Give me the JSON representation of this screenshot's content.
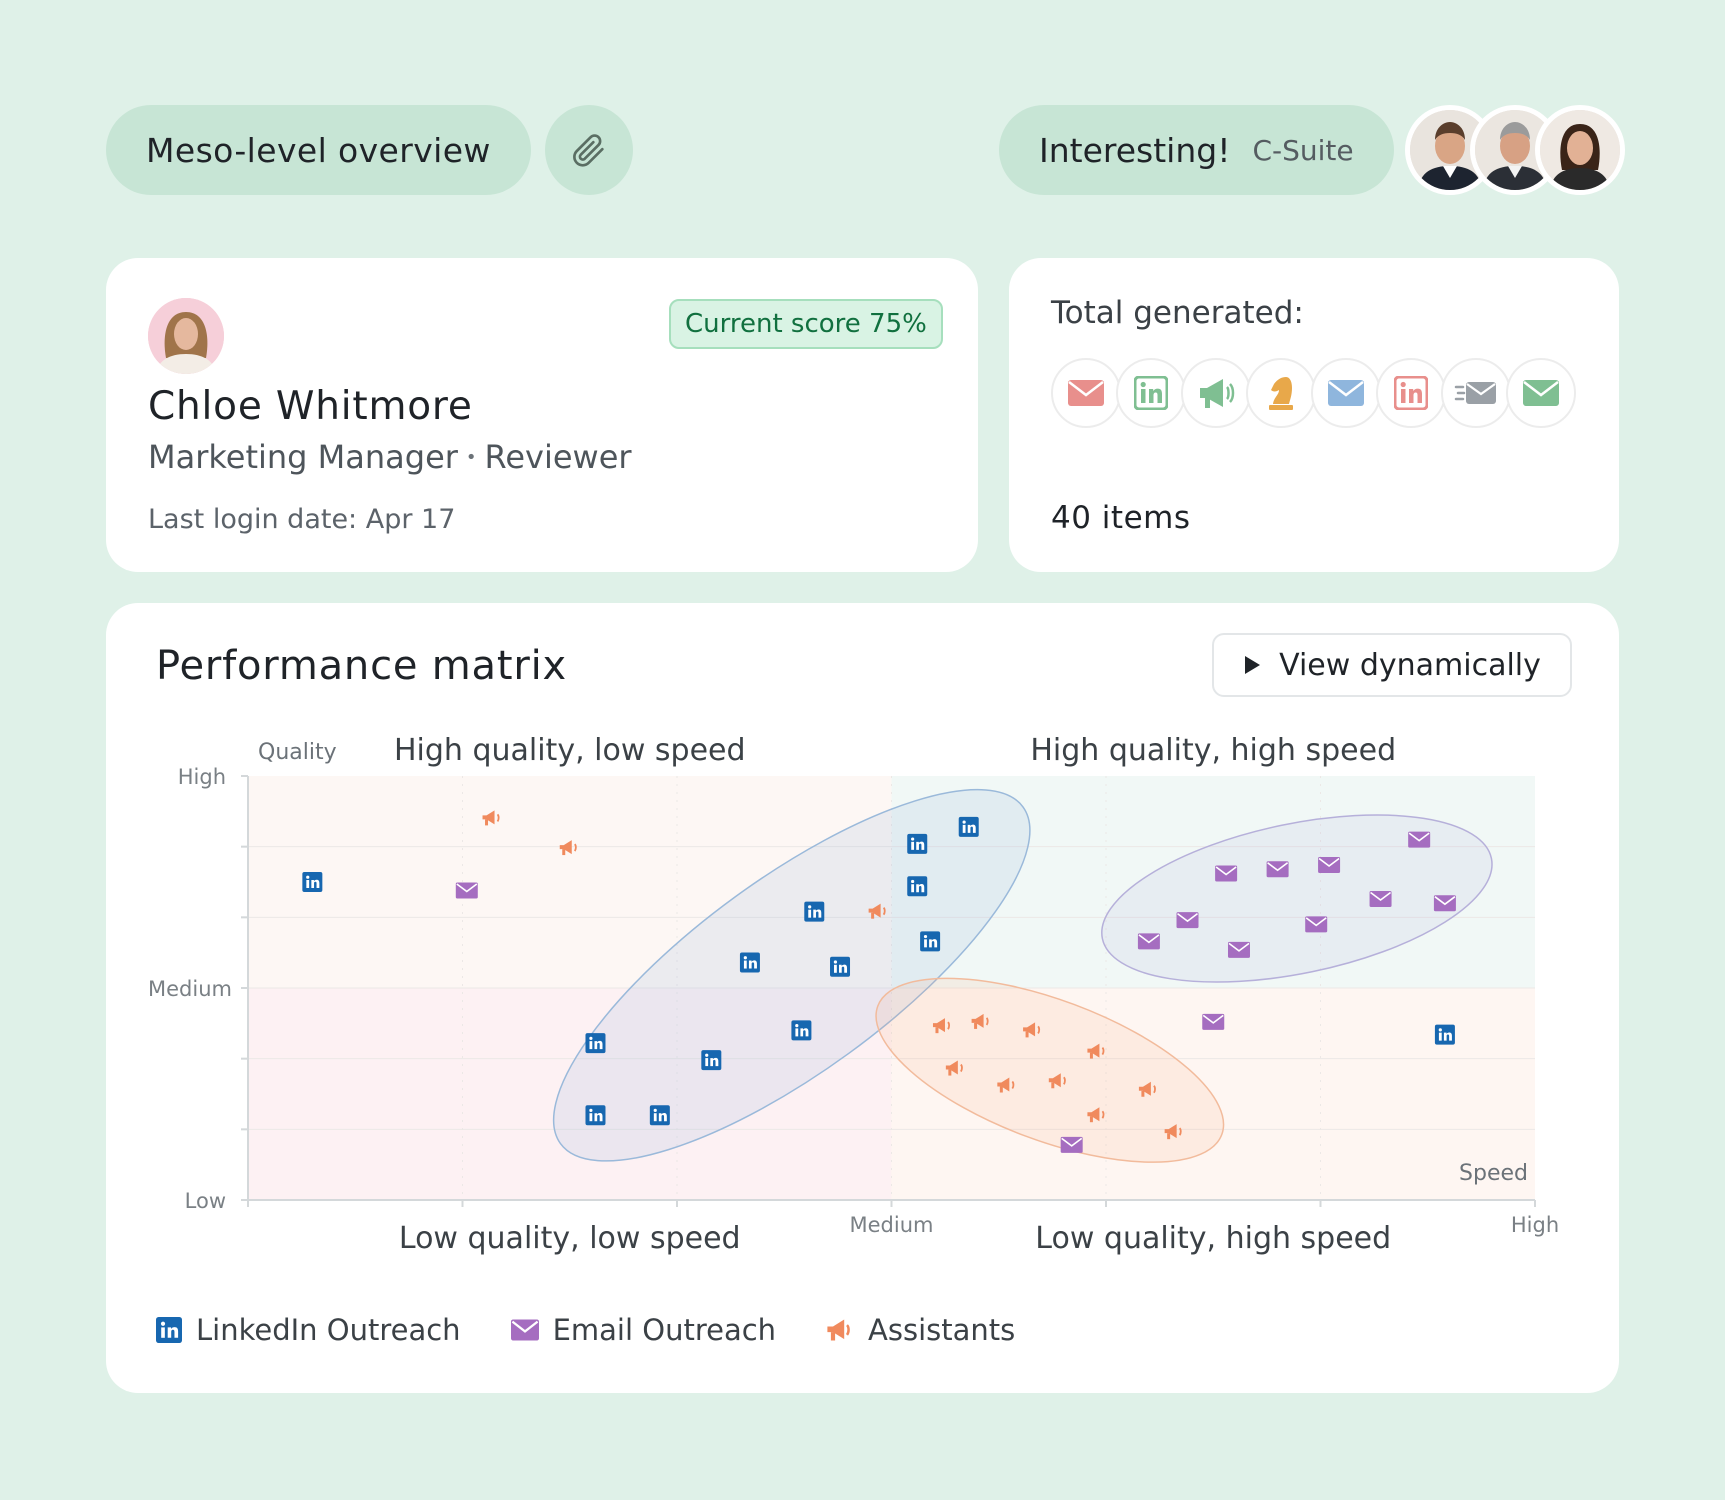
{
  "header": {
    "overview_label": "Meso-level overview",
    "interest_label": "Interesting!",
    "segment_label": "C-Suite"
  },
  "profile": {
    "score_badge": "Current score 75%",
    "name": "Chloe Whitmore",
    "role": "Marketing Manager",
    "role_separator": "•",
    "status": "Reviewer",
    "last_login": "Last login date: Apr 17"
  },
  "total": {
    "label": "Total generated:",
    "items": "40 items",
    "icons": [
      {
        "icon": "mail-icon",
        "color": "#e88f8c"
      },
      {
        "icon": "linkedin-icon",
        "color": "#7fbf92"
      },
      {
        "icon": "megaphone-icon",
        "color": "#7fbf92"
      },
      {
        "icon": "chess-knight-icon",
        "color": "#e8a84a"
      },
      {
        "icon": "mail-icon",
        "color": "#8fb6dd"
      },
      {
        "icon": "linkedin-icon",
        "color": "#e88f8c"
      },
      {
        "icon": "fast-mail-icon",
        "color": "#9aa0a6"
      },
      {
        "icon": "mail-icon",
        "color": "#7fbf92"
      }
    ]
  },
  "matrix": {
    "title": "Performance matrix",
    "view_button": "View dynamically"
  },
  "colors": {
    "background": "#dff1e8",
    "linkedin": "#1767b0",
    "email": "#a56dc0",
    "assistant": "#f08a5d"
  },
  "chart_data": {
    "type": "scatter",
    "xlabel": "Speed",
    "ylabel": "Quality",
    "x_ticks": [
      "Medium",
      "High"
    ],
    "y_ticks": [
      "High",
      "Medium",
      "Low"
    ],
    "xlim": [
      0,
      1
    ],
    "ylim": [
      0,
      1
    ],
    "quadrants": [
      {
        "label": "High quality, low speed"
      },
      {
        "label": "High quality, high speed"
      },
      {
        "label": "Low quality, low speed"
      },
      {
        "label": "Low quality, high speed"
      }
    ],
    "series": [
      {
        "name": "LinkedIn Outreach",
        "color": "#1767b0",
        "points": [
          [
            0.05,
            0.75
          ],
          [
            0.52,
            0.84
          ],
          [
            0.56,
            0.88
          ],
          [
            0.52,
            0.74
          ],
          [
            0.44,
            0.68
          ],
          [
            0.53,
            0.61
          ],
          [
            0.39,
            0.56
          ],
          [
            0.46,
            0.55
          ],
          [
            0.43,
            0.4
          ],
          [
            0.27,
            0.37
          ],
          [
            0.36,
            0.33
          ],
          [
            0.27,
            0.2
          ],
          [
            0.32,
            0.2
          ],
          [
            0.93,
            0.39
          ]
        ]
      },
      {
        "name": "Email Outreach",
        "color": "#a56dc0",
        "points": [
          [
            0.17,
            0.73
          ],
          [
            0.91,
            0.85
          ],
          [
            0.76,
            0.77
          ],
          [
            0.8,
            0.78
          ],
          [
            0.84,
            0.79
          ],
          [
            0.88,
            0.71
          ],
          [
            0.93,
            0.7
          ],
          [
            0.73,
            0.66
          ],
          [
            0.7,
            0.61
          ],
          [
            0.77,
            0.59
          ],
          [
            0.83,
            0.65
          ],
          [
            0.75,
            0.42
          ],
          [
            0.64,
            0.13
          ]
        ]
      },
      {
        "name": "Assistants",
        "color": "#f08a5d",
        "points": [
          [
            0.19,
            0.9
          ],
          [
            0.25,
            0.83
          ],
          [
            0.49,
            0.68
          ],
          [
            0.54,
            0.41
          ],
          [
            0.57,
            0.42
          ],
          [
            0.61,
            0.4
          ],
          [
            0.55,
            0.31
          ],
          [
            0.59,
            0.27
          ],
          [
            0.63,
            0.28
          ],
          [
            0.66,
            0.35
          ],
          [
            0.66,
            0.2
          ],
          [
            0.7,
            0.26
          ],
          [
            0.72,
            0.16
          ]
        ]
      }
    ],
    "clusters": [
      {
        "series": "LinkedIn Outreach"
      },
      {
        "series": "Email Outreach"
      },
      {
        "series": "Assistants"
      }
    ],
    "legend_position": "bottom-left"
  }
}
